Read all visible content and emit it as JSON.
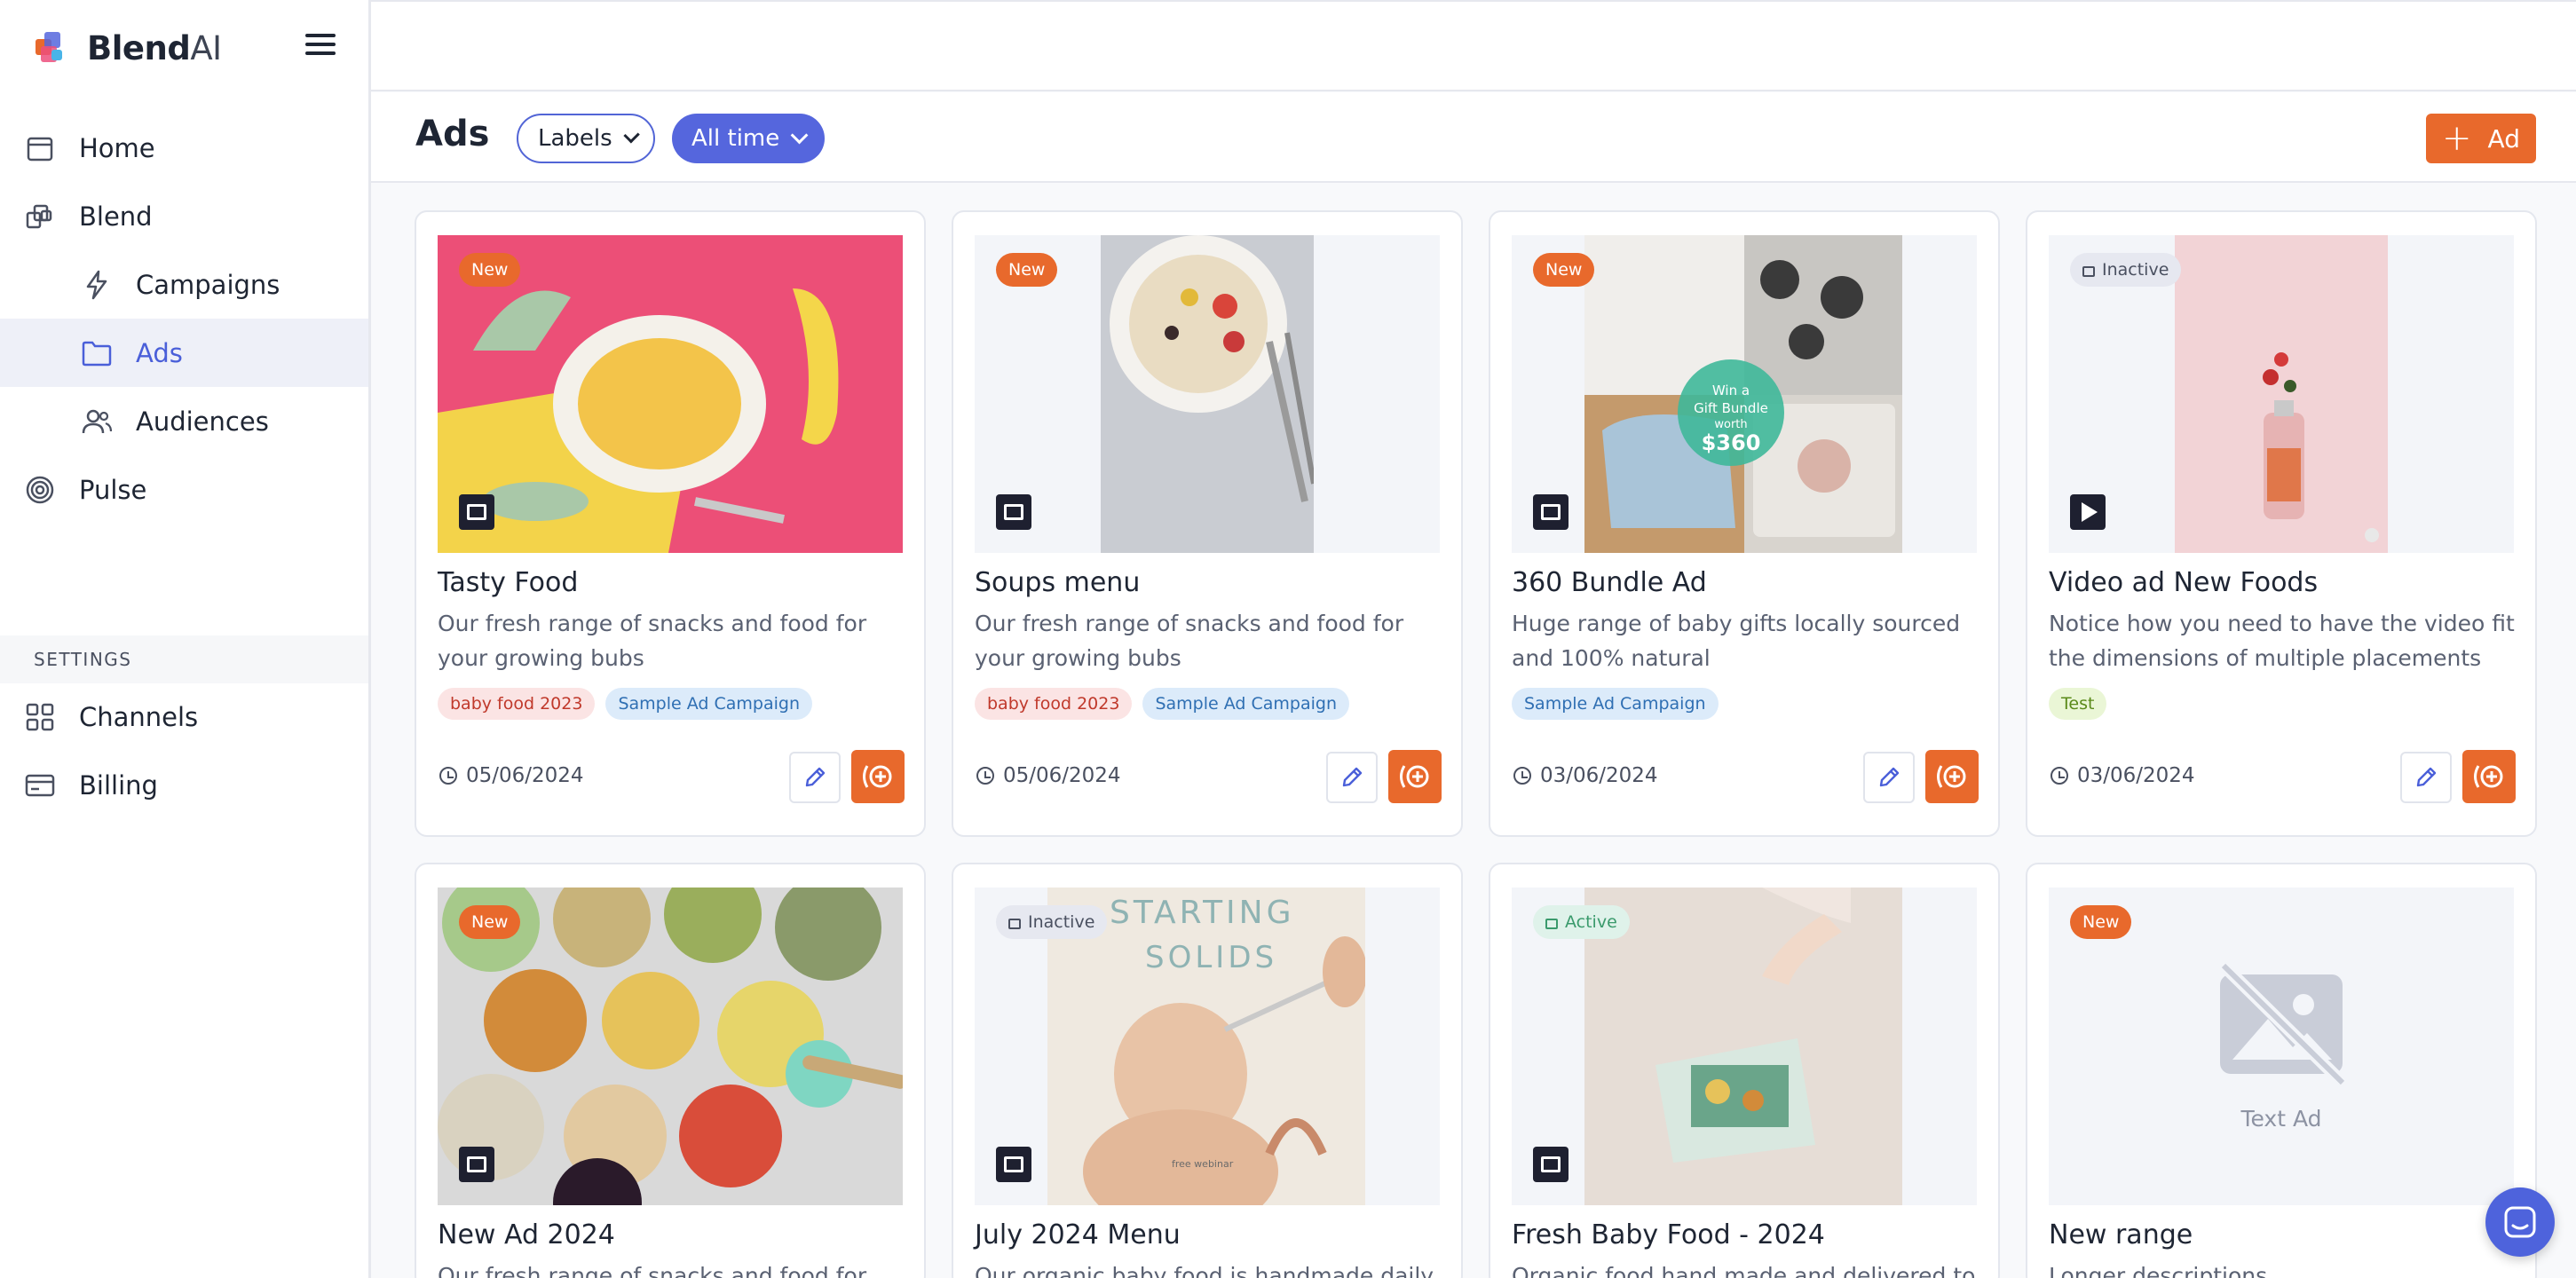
{
  "brand": {
    "name_bold": "Blend",
    "name_light": "AI"
  },
  "sidebar": {
    "items": [
      {
        "label": "Home"
      },
      {
        "label": "Blend"
      },
      {
        "label": "Campaigns"
      },
      {
        "label": "Ads"
      },
      {
        "label": "Audiences"
      },
      {
        "label": "Pulse"
      }
    ],
    "settings_heading": "SETTINGS",
    "settings_items": [
      {
        "label": "Channels"
      },
      {
        "label": "Billing"
      }
    ]
  },
  "header": {
    "title": "Ads",
    "labels_filter": "Labels",
    "time_filter": "All time",
    "add_label": "Ad"
  },
  "colors": {
    "accent": "#5566dd",
    "brand_orange": "#e8692c",
    "active_bg": "#eef0f8"
  },
  "cards": [
    {
      "badge": "New",
      "title": "Tasty Food",
      "desc": "Our fresh range of snacks and food for your growing bubs",
      "tags": [
        "baby food 2023",
        "Sample Ad Campaign"
      ],
      "date": "05/06/2024",
      "media": "image-icon"
    },
    {
      "badge": "New",
      "title": "Soups menu",
      "desc": "Our fresh range of snacks and food for your growing bubs",
      "tags": [
        "baby food 2023",
        "Sample Ad Campaign"
      ],
      "date": "05/06/2024",
      "media": "image-icon"
    },
    {
      "badge": "New",
      "title": "360 Bundle Ad",
      "desc": "Huge range of baby gifts locally sourced and 100% natural",
      "tags": [
        "Sample Ad Campaign"
      ],
      "date": "03/06/2024",
      "media": "image-icon",
      "overlay_text": [
        "Win a",
        "Gift Bundle",
        "worth",
        "$360"
      ]
    },
    {
      "badge": "Inactive",
      "title": "Video ad New Foods",
      "desc": "Notice how you need to have the video fit the dimensions of multiple placements",
      "tags": [
        "Test"
      ],
      "date": "03/06/2024",
      "media": "play-icon"
    },
    {
      "badge": "New",
      "title": "New Ad 2024",
      "desc": "Our fresh range of snacks and food for your growing bubs",
      "media": "image-icon"
    },
    {
      "badge": "Inactive",
      "title": "July 2024 Menu",
      "desc": "Our organic baby food is handmade daily and",
      "media": "image-icon",
      "overlay_text": [
        "STARTING",
        "SOLIDS",
        "free webinar"
      ]
    },
    {
      "badge": "Active",
      "title": "Fresh Baby Food - 2024",
      "desc": "Organic food hand made and delivered to",
      "media": "image-icon"
    },
    {
      "badge": "New",
      "title": "New range",
      "desc": "Longer descriptions",
      "placeholder": "Text Ad"
    }
  ]
}
